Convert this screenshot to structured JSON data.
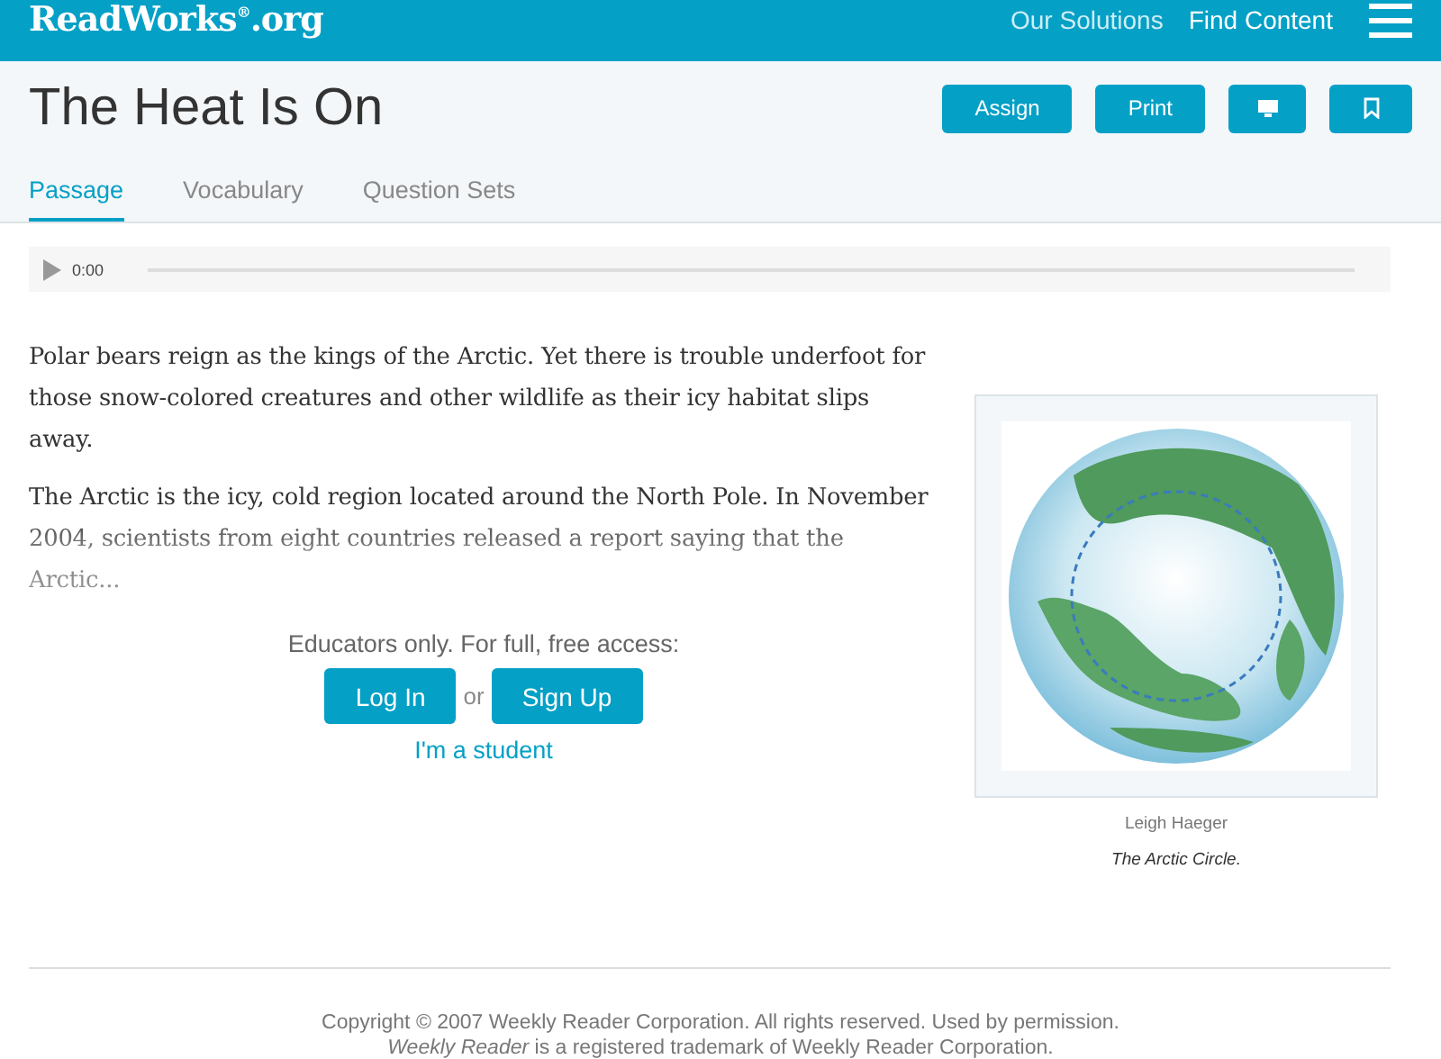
{
  "header": {
    "logo": "ReadWorks$^{®}$.org",
    "nav": [
      "Our Solutions",
      "Find Content"
    ]
  },
  "title": "The Heat Is On",
  "actions": [
    {
      "kind": "text",
      "label": "Assign"
    },
    {
      "kind": "text",
      "label": "Print"
    },
    {
      "kind": "screen"
    },
    {
      "kind": "bookmark"
    }
  ],
  "tabs": [
    {
      "label": "Passage",
      "selected": true
    },
    {
      "label": "Vocabulary",
      "selected": false
    },
    {
      "label": "Question Sets",
      "selected": false
    }
  ],
  "audio": {
    "time": "0:00"
  },
  "paragraphs": [
    "Polar bears reign as the kings of the Arctic. Yet there is trouble underfoot for those snow-colored creatures and other wildlife as their icy habitat slips away.",
    "The Arctic is the icy, cold region located around the North Pole. In November 2004, scientists from eight countries released a report saying that the Arctic..."
  ],
  "access": {
    "prompt": "Educators only. For full, free access:",
    "login": "Log In",
    "or": "or",
    "signup": "Sign Up",
    "student": "I'm a student"
  },
  "figure": {
    "credit": "Leigh Haeger",
    "caption": "The Arctic Circle."
  },
  "footer": [
    "Copyright © 2007 Weekly Reader Corporation. All rights reserved. Used by permission.",
    "*Weekly Reader* is a registered trademark of Weekly Reader Corporation."
  ]
}
